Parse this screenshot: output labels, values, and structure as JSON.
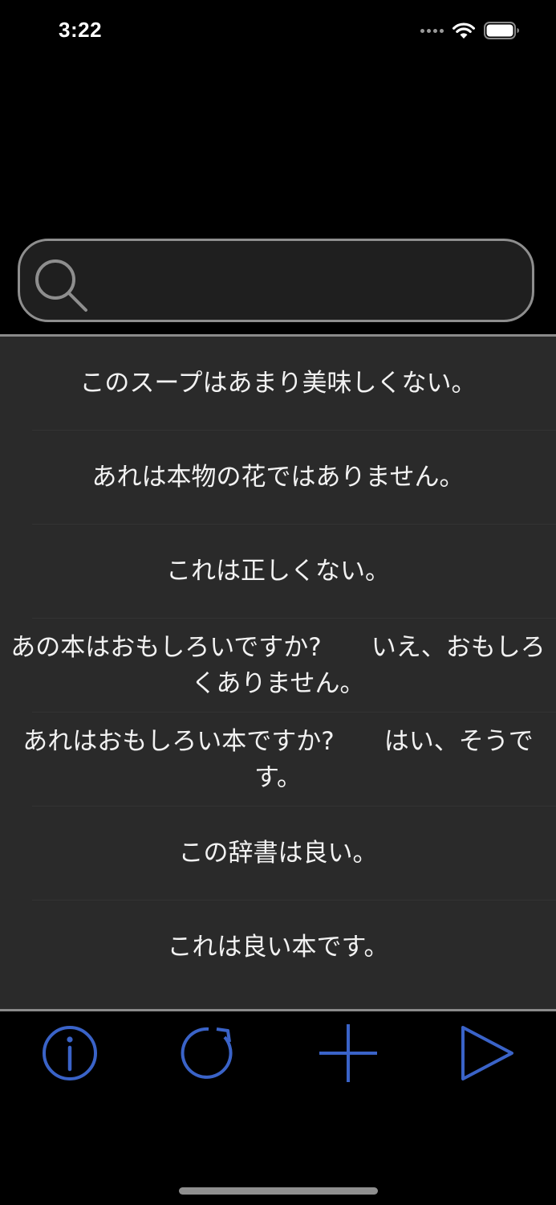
{
  "status_bar": {
    "time": "3:22"
  },
  "search": {
    "value": "",
    "placeholder": ""
  },
  "sentences": [
    "このスープはあまり美味しくない。",
    "あれは本物の花ではありません。",
    "これは正しくない。",
    "あの本はおもしろいですか?　　いえ、おもしろくありません。",
    "あれはおもしろい本ですか?　　はい、そうです。",
    "この辞書は良い。",
    "これは良い本です。"
  ],
  "toolbar": {
    "icons": [
      "info-icon",
      "refresh-icon",
      "add-icon",
      "play-icon"
    ]
  },
  "colors": {
    "accent": "#3a63c8",
    "list_background": "#2a2a2a",
    "search_border": "#8e8e8e"
  }
}
